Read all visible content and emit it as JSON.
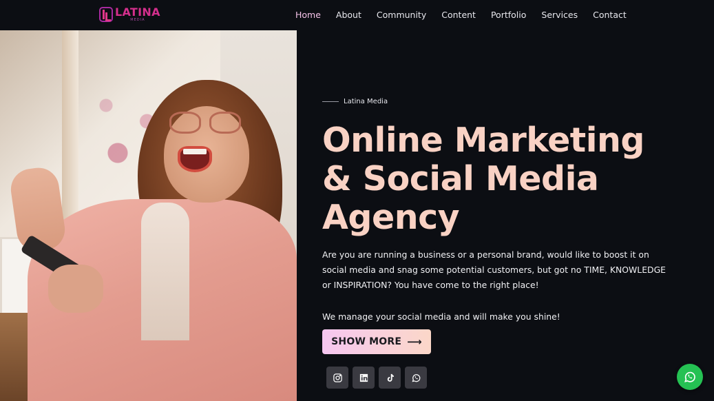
{
  "brand": {
    "logo_text": "LATINA",
    "logo_subtext": "MEDIA",
    "accent": "#f9d2c4"
  },
  "nav": {
    "items": [
      {
        "label": "Home",
        "active": true
      },
      {
        "label": "About",
        "active": false
      },
      {
        "label": "Community",
        "active": false
      },
      {
        "label": "Content",
        "active": false
      },
      {
        "label": "Portfolio",
        "active": false
      },
      {
        "label": "Services",
        "active": false
      },
      {
        "label": "Contact",
        "active": false
      }
    ]
  },
  "hero": {
    "eyebrow": "Latina Media",
    "title_lines": [
      "Online Marketing",
      "& Social Media",
      "Agency"
    ],
    "description": "Are you are running a business or a personal brand, would like to boost it on social media and snag some potential customers, but got no TIME, KNOWLEDGE or INSPIRATION? You have come to the right place!",
    "tagline": "We manage your social media and will make you shine!",
    "cta_label": "SHOW MORE",
    "cta_icon": "arrow-right-icon"
  },
  "socials": [
    {
      "name": "instagram-icon"
    },
    {
      "name": "linkedin-icon"
    },
    {
      "name": "tiktok-icon"
    },
    {
      "name": "whatsapp-icon"
    }
  ],
  "floating_button": {
    "icon": "whatsapp-icon",
    "color": "#25c153"
  }
}
